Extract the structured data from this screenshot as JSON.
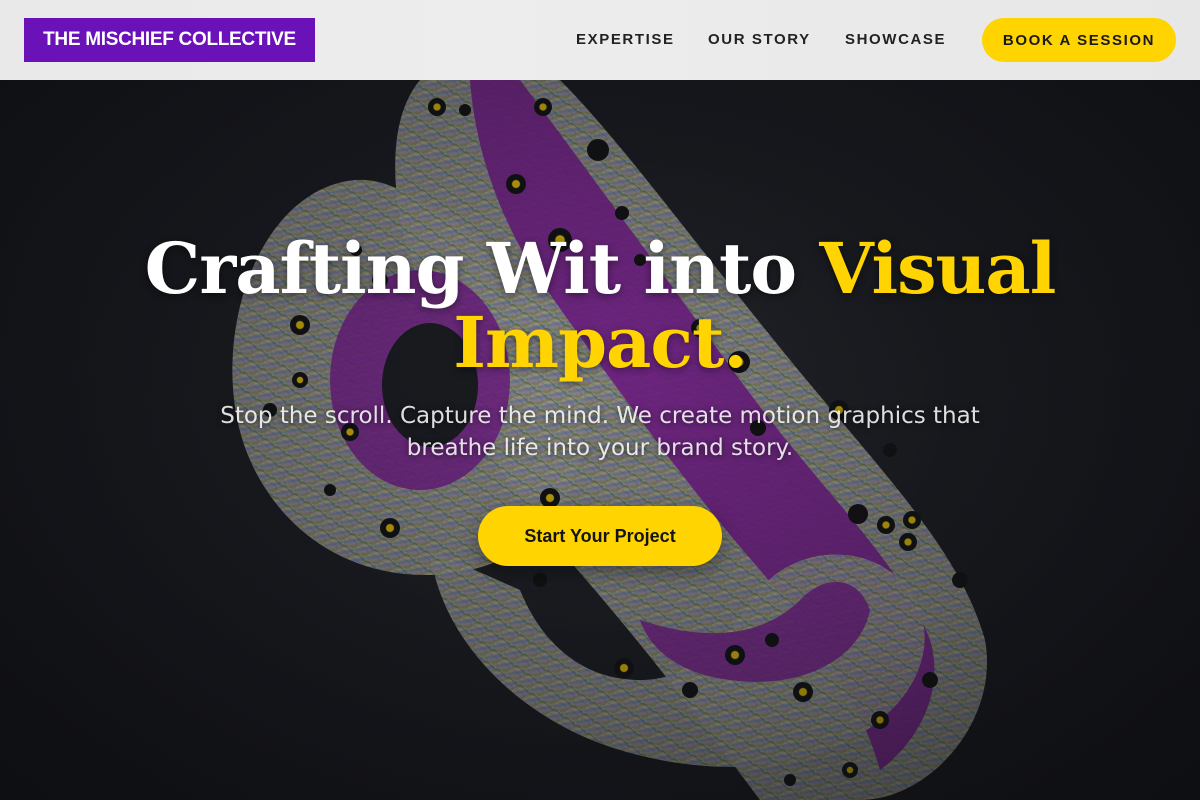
{
  "header": {
    "logo_text": "THE MISCHIEF COLLECTIVE",
    "nav": {
      "expertise": "EXPERTISE",
      "our_story": "OUR STORY",
      "showcase": "SHOWCASE"
    },
    "book_button": "BOOK A SESSION"
  },
  "hero": {
    "headline_white": "Crafting Wit into ",
    "headline_accent_1": "Visual",
    "headline_accent_2": "Impact.",
    "subheadline": "Stop the scroll. Capture the mind. We create motion graphics that breathe life into your brand story.",
    "cta_button": "Start Your Project",
    "background_art": "abstract-3d-sculpture"
  },
  "colors": {
    "brand_purple": "#6a12b8",
    "accent_yellow": "#ffd400",
    "nav_background": "#e9e9e9",
    "hero_background": "#1b1d22"
  }
}
